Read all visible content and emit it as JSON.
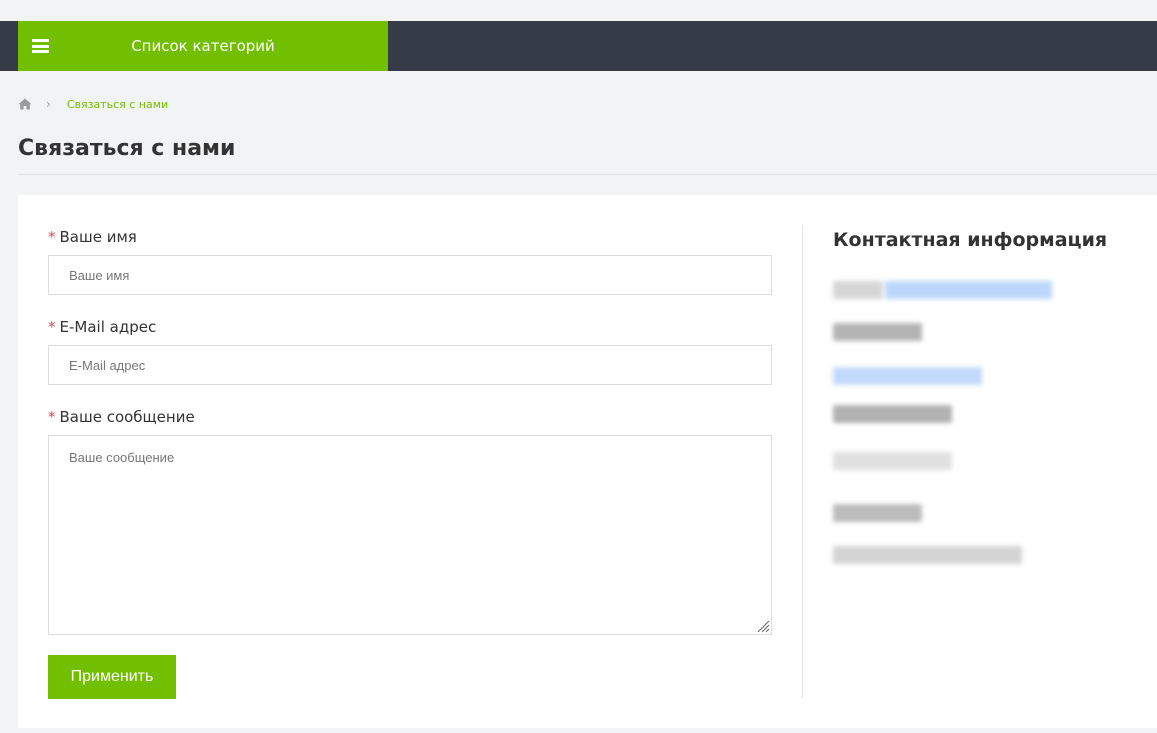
{
  "header": {
    "categories_label": "Список категорий",
    "accent_color": "#72bf00",
    "bar_color": "#363c47"
  },
  "breadcrumb": {
    "home_icon": "home-icon",
    "current": "Связаться с нами"
  },
  "page": {
    "title": "Связаться с нами"
  },
  "form": {
    "required_mark": "*",
    "name_label": "Ваше имя",
    "name_placeholder": "Ваше имя",
    "email_label": "E-Mail адрес",
    "email_placeholder": "E-Mail адрес",
    "message_label": "Ваше сообщение",
    "message_placeholder": "Ваше сообщение",
    "submit_label": "Применить"
  },
  "contact": {
    "title": "Контактная информация"
  }
}
